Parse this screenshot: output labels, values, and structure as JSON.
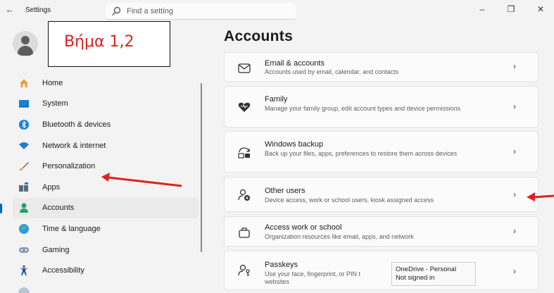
{
  "window": {
    "back_glyph": "←",
    "title": "Settings",
    "minimize_glyph": "–",
    "restore_glyph": "❐",
    "close_glyph": "✕"
  },
  "search": {
    "placeholder": "Find a setting",
    "icon": "search-icon"
  },
  "annotation": {
    "label": "Βήμα 1,2",
    "color": "#e02020"
  },
  "nav": {
    "items": [
      {
        "label": "Home",
        "icon": "home-icon"
      },
      {
        "label": "System",
        "icon": "system-icon"
      },
      {
        "label": "Bluetooth & devices",
        "icon": "bluetooth-icon"
      },
      {
        "label": "Network & internet",
        "icon": "wifi-icon"
      },
      {
        "label": "Personalization",
        "icon": "brush-icon"
      },
      {
        "label": "Apps",
        "icon": "apps-icon"
      },
      {
        "label": "Accounts",
        "icon": "accounts-icon",
        "active": true
      },
      {
        "label": "Time & language",
        "icon": "globe-icon"
      },
      {
        "label": "Gaming",
        "icon": "gamepad-icon"
      },
      {
        "label": "Accessibility",
        "icon": "accessibility-icon"
      }
    ]
  },
  "main": {
    "title": "Accounts",
    "cards": [
      {
        "title": "Email & accounts",
        "subtitle": "Accounts used by email, calendar, and contacts",
        "icon": "mail-icon"
      },
      {
        "title": "Family",
        "subtitle": "Manage your family group, edit account types and device permissions",
        "icon": "heart-icon"
      },
      {
        "title": "Windows backup",
        "subtitle": "Back up your files, apps, preferences to restore them across devices",
        "icon": "backup-icon"
      },
      {
        "title": "Other users",
        "subtitle": "Device access, work or school users, kiosk assigned access",
        "icon": "add-user-icon"
      },
      {
        "title": "Access work or school",
        "subtitle": "Organization resources like email, apps, and network",
        "icon": "briefcase-icon"
      },
      {
        "title": "Passkeys",
        "subtitle": "Use your face, fingerprint, or PIN t",
        "subtitle2": "websites",
        "icon": "passkey-icon"
      }
    ],
    "chevron": "›"
  },
  "tooltip": {
    "line1": "OneDrive - Personal",
    "line2": "Not signed in"
  },
  "colors": {
    "accent": "#0067c0",
    "arrow": "#e02020"
  }
}
